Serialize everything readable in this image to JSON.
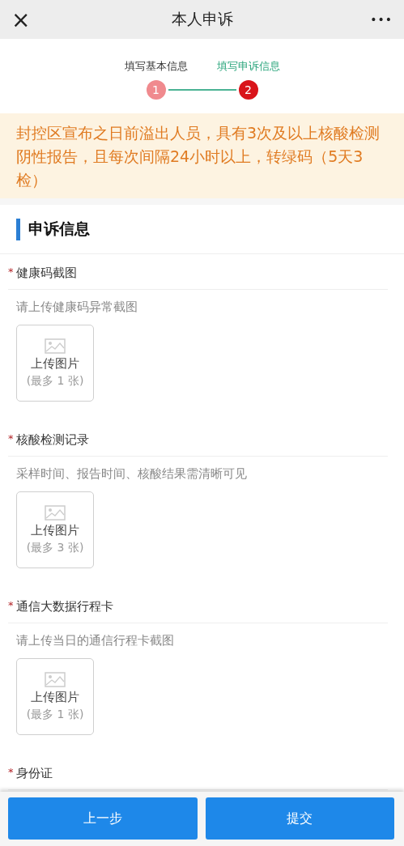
{
  "header": {
    "close": "×",
    "title": "本人申诉",
    "more": "•••"
  },
  "steps": [
    {
      "label": "填写基本信息",
      "number": "1",
      "selected": false
    },
    {
      "label": "填写申诉信息",
      "number": "2",
      "selected": true
    }
  ],
  "notice": "封控区宣布之日前溢出人员，具有3次及以上核酸检测阴性报告，且每次间隔24小时以上，转绿码（5天3检）",
  "section_title": "申诉信息",
  "fields": [
    {
      "required_mark": "*",
      "label": "健康码截图",
      "hint": "请上传健康码异常截图",
      "upload": {
        "label": "上传图片",
        "limit": "(最多 1 张)"
      }
    },
    {
      "required_mark": "*",
      "label": "核酸检测记录",
      "hint": "采样时间、报告时间、核酸结果需清晰可见",
      "upload": {
        "label": "上传图片",
        "limit": "(最多 3 张)"
      }
    },
    {
      "required_mark": "*",
      "label": "通信大数据行程卡",
      "hint": "请上传当日的通信行程卡截图",
      "upload": {
        "label": "上传图片",
        "limit": "(最多 1 张)"
      }
    },
    {
      "required_mark": "*",
      "label": "身份证"
    }
  ],
  "buttons": [
    "上一步",
    "提交"
  ]
}
